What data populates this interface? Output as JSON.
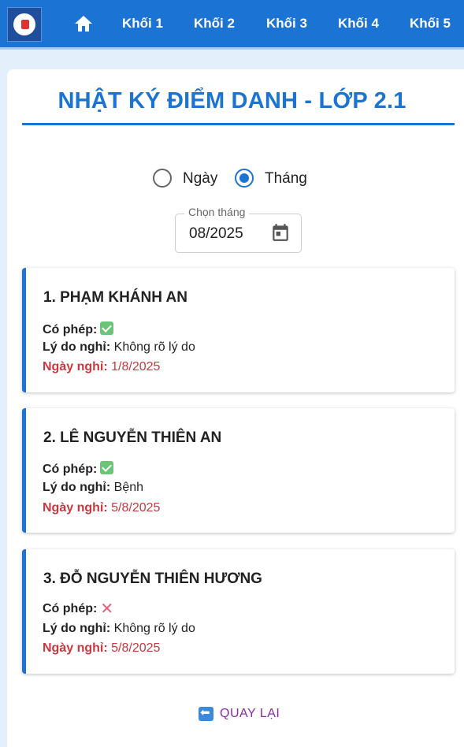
{
  "nav": {
    "items": [
      {
        "label": "Khối 1"
      },
      {
        "label": "Khối 2"
      },
      {
        "label": "Khối 3"
      },
      {
        "label": "Khối 4"
      },
      {
        "label": "Khối 5"
      }
    ]
  },
  "page": {
    "title": "NHẬT KÝ ĐIỂM DANH - LỚP 2.1"
  },
  "filter": {
    "options": [
      {
        "label": "Ngày",
        "checked": false
      },
      {
        "label": "Tháng",
        "checked": true
      }
    ],
    "month_legend": "Chọn tháng",
    "month_value": "08/2025"
  },
  "labels": {
    "permission": "Có phép:",
    "reason": "Lý do nghỉ:",
    "date": "Ngày nghỉ:"
  },
  "entries": [
    {
      "name": "1. PHẠM KHÁNH AN",
      "permitted": true,
      "reason": "Không rõ lý do",
      "date": "1/8/2025"
    },
    {
      "name": "2. LÊ NGUYỄN THIÊN AN",
      "permitted": true,
      "reason": "Bệnh",
      "date": "5/8/2025"
    },
    {
      "name": "3. ĐỖ NGUYỄN THIÊN HƯƠNG",
      "permitted": false,
      "reason": "Không rõ lý do",
      "date": "5/8/2025"
    }
  ],
  "footer": {
    "back_label": "QUAY LẠI"
  },
  "colors": {
    "primary": "#1b73d3",
    "date_red": "#c8383f",
    "back_purple": "#8a2aa8"
  }
}
